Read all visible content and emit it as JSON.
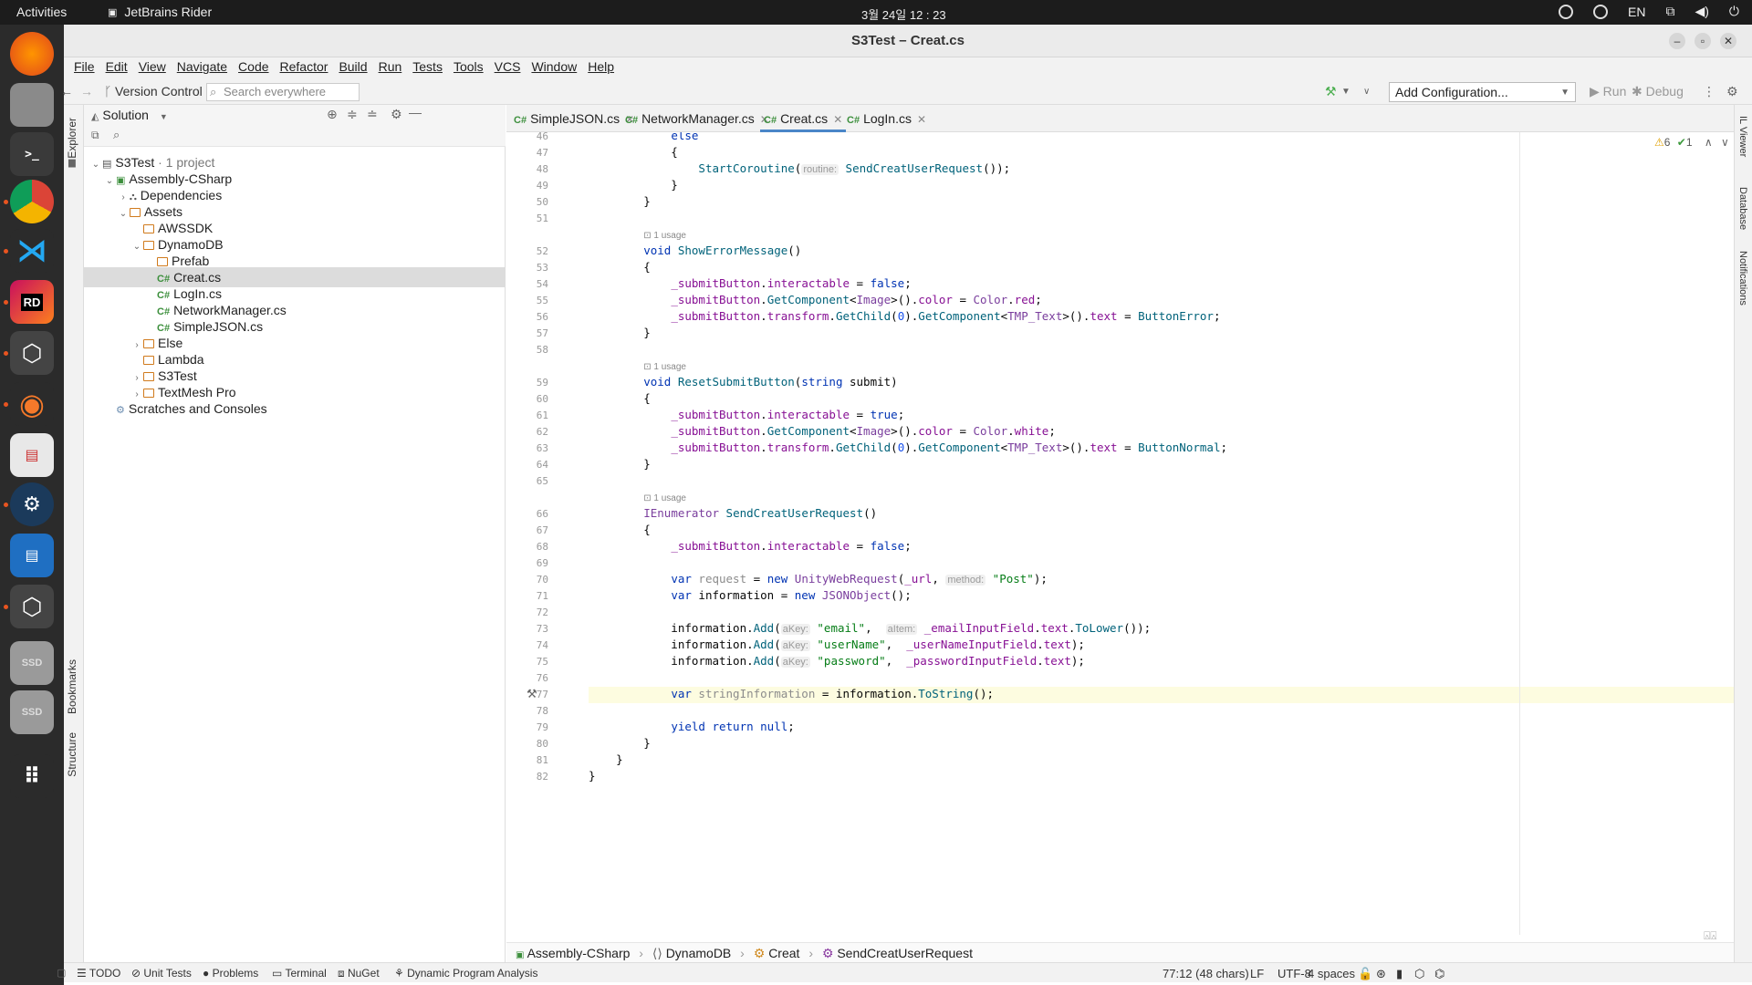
{
  "os": {
    "activities": "Activities",
    "app_name": "JetBrains Rider",
    "clock": "3월 24일  12 : 23",
    "lang": "EN"
  },
  "window": {
    "title": "S3Test – Creat.cs"
  },
  "menu": [
    "File",
    "Edit",
    "View",
    "Navigate",
    "Code",
    "Refactor",
    "Build",
    "Run",
    "Tests",
    "Tools",
    "VCS",
    "Window",
    "Help"
  ],
  "toolbar": {
    "vcs": "Version Control",
    "search_placeholder": "Search everywhere",
    "config": "Add Configuration...",
    "run": "Run",
    "debug": "Debug"
  },
  "left_strip": {
    "explorer": "Explorer",
    "bookmarks": "Bookmarks",
    "structure": "Structure"
  },
  "right_strip": {
    "il_viewer": "IL Viewer",
    "database": "Database",
    "notifications": "Notifications"
  },
  "explorer": {
    "header": "Solution",
    "tree": [
      {
        "label": "S3Test",
        "suffix": " · 1 project",
        "icon": "solution",
        "level": 0,
        "expanded": true
      },
      {
        "label": "Assembly-CSharp",
        "icon": "cs-project",
        "level": 1,
        "expanded": true
      },
      {
        "label": "Dependencies",
        "icon": "deps",
        "level": 2,
        "expanded": false
      },
      {
        "label": "Assets",
        "icon": "folder",
        "level": 2,
        "expanded": true
      },
      {
        "label": "AWSSDK",
        "icon": "folder",
        "level": 3
      },
      {
        "label": "DynamoDB",
        "icon": "folder",
        "level": 3,
        "expanded": true
      },
      {
        "label": "Prefab",
        "icon": "folder",
        "level": 4
      },
      {
        "label": "Creat.cs",
        "icon": "cs",
        "level": 4,
        "selected": true
      },
      {
        "label": "LogIn.cs",
        "icon": "cs",
        "level": 4
      },
      {
        "label": "NetworkManager.cs",
        "icon": "cs",
        "level": 4
      },
      {
        "label": "SimpleJSON.cs",
        "icon": "cs",
        "level": 4
      },
      {
        "label": "Else",
        "icon": "folder",
        "level": 3,
        "expanded": false
      },
      {
        "label": "Lambda",
        "icon": "folder",
        "level": 3
      },
      {
        "label": "S3Test",
        "icon": "folder",
        "level": 3,
        "expanded": false
      },
      {
        "label": "TextMesh Pro",
        "icon": "folder",
        "level": 3,
        "expanded": false
      },
      {
        "label": "Scratches and Consoles",
        "icon": "scratch",
        "level": 1
      }
    ]
  },
  "tabs": [
    {
      "label": "SimpleJSON.cs",
      "active": false
    },
    {
      "label": "NetworkManager.cs",
      "active": false
    },
    {
      "label": "Creat.cs",
      "active": true
    },
    {
      "label": "LogIn.cs",
      "active": false
    }
  ],
  "inspections": {
    "warnings": "6",
    "ok": "1"
  },
  "code_lines": [
    {
      "n": "46",
      "html": "            <span class=\"kw\">else</span>"
    },
    {
      "n": "47",
      "html": "            {"
    },
    {
      "n": "48",
      "html": "                <span class=\"fn\">StartCoroutine</span>(<span class=\"hint\">routine:</span> <span class=\"fn\">SendCreatUserRequest</span>());"
    },
    {
      "n": "49",
      "html": "            }"
    },
    {
      "n": "50",
      "html": "        }"
    },
    {
      "n": "51",
      "html": ""
    },
    {
      "n": "",
      "html": "        <span class=\"usage\">⊡ 1 usage</span>"
    },
    {
      "n": "52",
      "html": "        <span class=\"kw\">void</span> <span class=\"fn\">ShowErrorMessage</span>()"
    },
    {
      "n": "53",
      "html": "        {"
    },
    {
      "n": "54",
      "html": "            <span class=\"mb\">_submitButton</span>.<span class=\"mb\">interactable</span> = <span class=\"kw\">false</span>;"
    },
    {
      "n": "55",
      "html": "            <span class=\"mb\">_submitButton</span>.<span class=\"fn\">GetComponent</span>&lt;<span class=\"ty\">Image</span>&gt;().<span class=\"mb\">color</span> = <span class=\"ty\">Color</span>.<span class=\"mb\">red</span>;"
    },
    {
      "n": "56",
      "html": "            <span class=\"mb\">_submitButton</span>.<span class=\"mb\">transform</span>.<span class=\"fn\">GetChild</span>(<span class=\"num\">0</span>).<span class=\"fn\">GetComponent</span>&lt;<span class=\"ty\">TMP_Text</span>&gt;().<span class=\"mb\">text</span> = <span class=\"fn\">ButtonError</span>;"
    },
    {
      "n": "57",
      "html": "        }"
    },
    {
      "n": "58",
      "html": ""
    },
    {
      "n": "",
      "html": "        <span class=\"usage\">⊡ 1 usage</span>"
    },
    {
      "n": "59",
      "html": "        <span class=\"kw\">void</span> <span class=\"fn\">ResetSubmitButton</span>(<span class=\"kw\">string</span> submit)"
    },
    {
      "n": "60",
      "html": "        {"
    },
    {
      "n": "61",
      "html": "            <span class=\"mb\">_submitButton</span>.<span class=\"mb\">interactable</span> = <span class=\"kw\">true</span>;"
    },
    {
      "n": "62",
      "html": "            <span class=\"mb\">_submitButton</span>.<span class=\"fn\">GetComponent</span>&lt;<span class=\"ty\">Image</span>&gt;().<span class=\"mb\">color</span> = <span class=\"ty\">Color</span>.<span class=\"mb\">white</span>;"
    },
    {
      "n": "63",
      "html": "            <span class=\"mb\">_submitButton</span>.<span class=\"mb\">transform</span>.<span class=\"fn\">GetChild</span>(<span class=\"num\">0</span>).<span class=\"fn\">GetComponent</span>&lt;<span class=\"ty\">TMP_Text</span>&gt;().<span class=\"mb\">text</span> = <span class=\"fn\">ButtonNormal</span>;"
    },
    {
      "n": "64",
      "html": "        }"
    },
    {
      "n": "65",
      "html": ""
    },
    {
      "n": "",
      "html": "        <span class=\"usage\">⊡ 1 usage</span>"
    },
    {
      "n": "66",
      "html": "        <span class=\"ty\">IEnumerator</span> <span class=\"fn\">SendCreatUserRequest</span>()"
    },
    {
      "n": "67",
      "html": "        {"
    },
    {
      "n": "68",
      "html": "            <span class=\"mb\">_submitButton</span>.<span class=\"mb\">interactable</span> = <span class=\"kw\">false</span>;"
    },
    {
      "n": "69",
      "html": ""
    },
    {
      "n": "70",
      "html": "            <span class=\"kw\">var</span> <span class=\"unused\">request</span> = <span class=\"kw\">new</span> <span class=\"ty\">UnityWebRequest</span>(<span class=\"mb\">_url</span>, <span class=\"hint\">method:</span> <span class=\"str\">\"Post\"</span>);"
    },
    {
      "n": "71",
      "html": "            <span class=\"kw\">var</span> information = <span class=\"kw\">new</span> <span class=\"ty\">JSONObject</span>();"
    },
    {
      "n": "72",
      "html": ""
    },
    {
      "n": "73",
      "html": "            information.<span class=\"fn\">Add</span>(<span class=\"hint\">aKey:</span> <span class=\"str\">\"email\"</span>,  <span class=\"hint\">aItem:</span> <span class=\"mb\">_emailInputField</span>.<span class=\"mb\">text</span>.<span class=\"fn\">ToLower</span>());"
    },
    {
      "n": "74",
      "html": "            information.<span class=\"fn\">Add</span>(<span class=\"hint\">aKey:</span> <span class=\"str\">\"userName\"</span>,  <span class=\"mb\">_userNameInputField</span>.<span class=\"mb\">text</span>);"
    },
    {
      "n": "75",
      "html": "            information.<span class=\"fn\">Add</span>(<span class=\"hint\">aKey:</span> <span class=\"str\">\"password\"</span>,  <span class=\"mb\">_passwordInputField</span>.<span class=\"mb\">text</span>);"
    },
    {
      "n": "76",
      "html": ""
    },
    {
      "n": "77",
      "html": "            <span class=\"kw\">var</span> <span class=\"unused\">stringInformation</span> = information.<span class=\"fn\">ToString</span>();"
    },
    {
      "n": "78",
      "html": ""
    },
    {
      "n": "79",
      "html": "            <span class=\"kw\">yield return null</span>;"
    },
    {
      "n": "80",
      "html": "        }"
    },
    {
      "n": "81",
      "html": "    }"
    },
    {
      "n": "82",
      "html": "}"
    }
  ],
  "breadcrumbs": [
    "Assembly-CSharp",
    "DynamoDB",
    "Creat",
    "SendCreatUserRequest"
  ],
  "bottom_tools": [
    "TODO",
    "Unit Tests",
    "Problems",
    "Terminal",
    "NuGet",
    "Dynamic Program Analysis"
  ],
  "status": {
    "position": "77:12 (48 chars)",
    "line_sep": "LF",
    "encoding": "UTF-8",
    "indent": "4 spaces"
  },
  "colors": {
    "accent": "#4a86c8",
    "brand": "#e95420"
  }
}
